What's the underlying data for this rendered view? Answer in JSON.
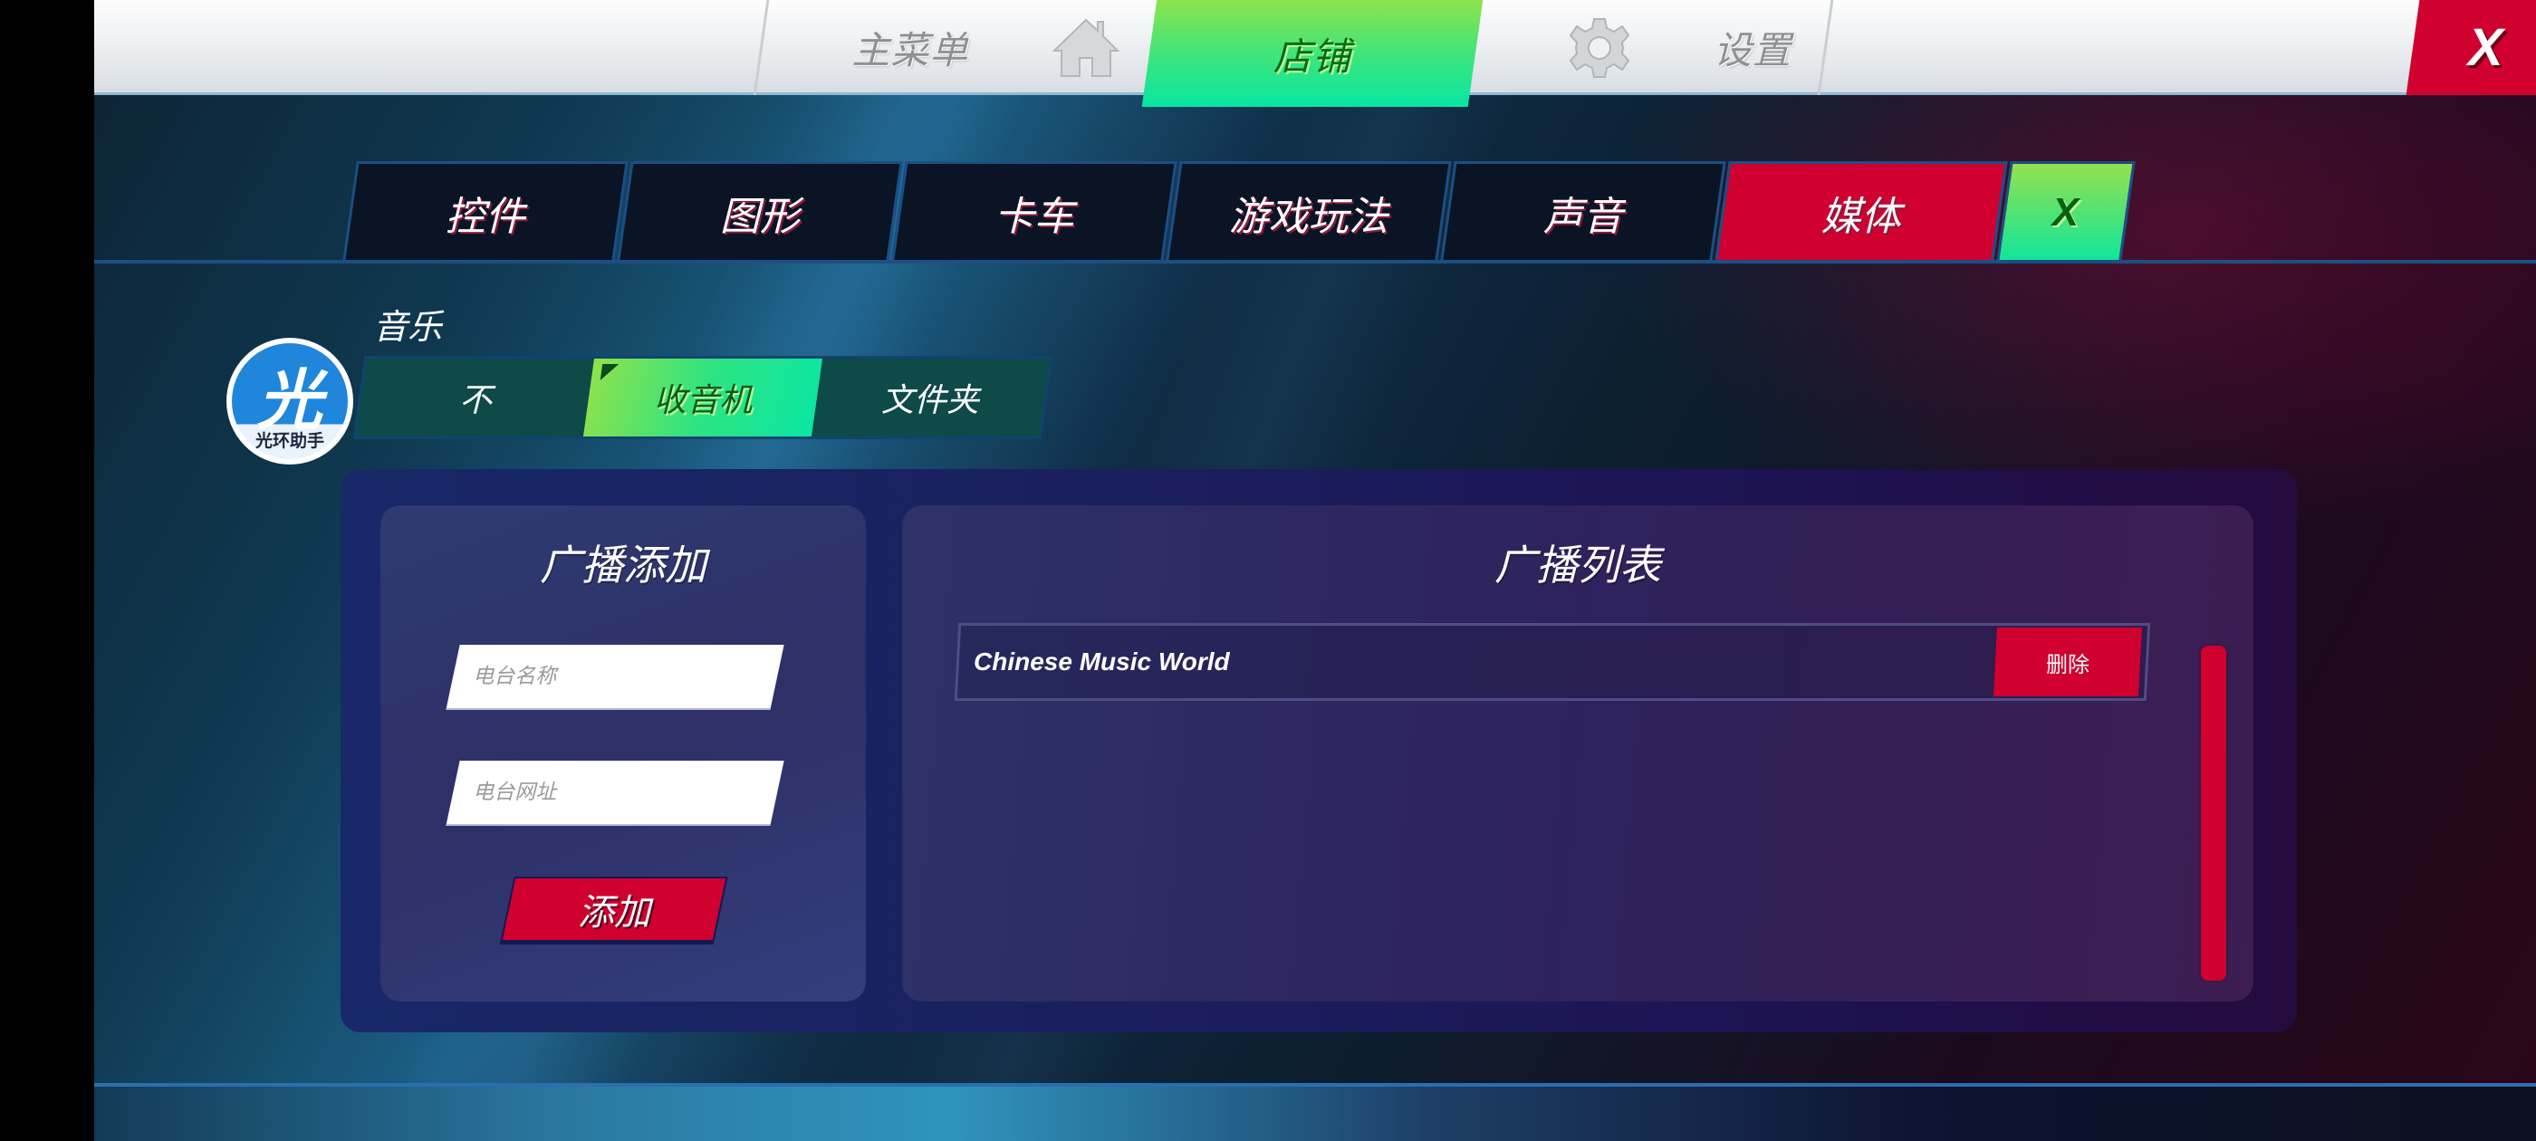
{
  "top_nav": {
    "main_menu": {
      "label": "主菜单",
      "icon": "home-icon"
    },
    "shop": {
      "label": "店铺",
      "active": true
    },
    "settings": {
      "label": "设置",
      "icon": "gear-icon"
    },
    "close": {
      "label": "X"
    }
  },
  "settings_tabs": {
    "items": [
      {
        "label": "控件",
        "active": false
      },
      {
        "label": "图形",
        "active": false
      },
      {
        "label": "卡车",
        "active": false
      },
      {
        "label": "游戏玩法",
        "active": false
      },
      {
        "label": "声音",
        "active": false
      },
      {
        "label": "媒体",
        "active": true
      }
    ],
    "close_label": "X"
  },
  "logo": {
    "char": "光",
    "text": "光环助手"
  },
  "music": {
    "label": "音乐",
    "options": [
      {
        "label": "不",
        "active": false
      },
      {
        "label": "收音机",
        "active": true
      },
      {
        "label": "文件夹",
        "active": false
      }
    ]
  },
  "add_panel": {
    "title": "广播添加",
    "name_field": {
      "placeholder": "电台名称",
      "value": ""
    },
    "url_field": {
      "placeholder": "电台网址",
      "value": ""
    },
    "add_button": "添加"
  },
  "list_panel": {
    "title": "广播列表",
    "stations": [
      {
        "name": "Chinese Music World",
        "delete_label": "删除"
      }
    ]
  },
  "colors": {
    "accent_red": "#d0002f",
    "accent_green_top": "#8ee34d",
    "accent_green_bottom": "#07e6a3",
    "tab_dark": "#0a1424"
  }
}
